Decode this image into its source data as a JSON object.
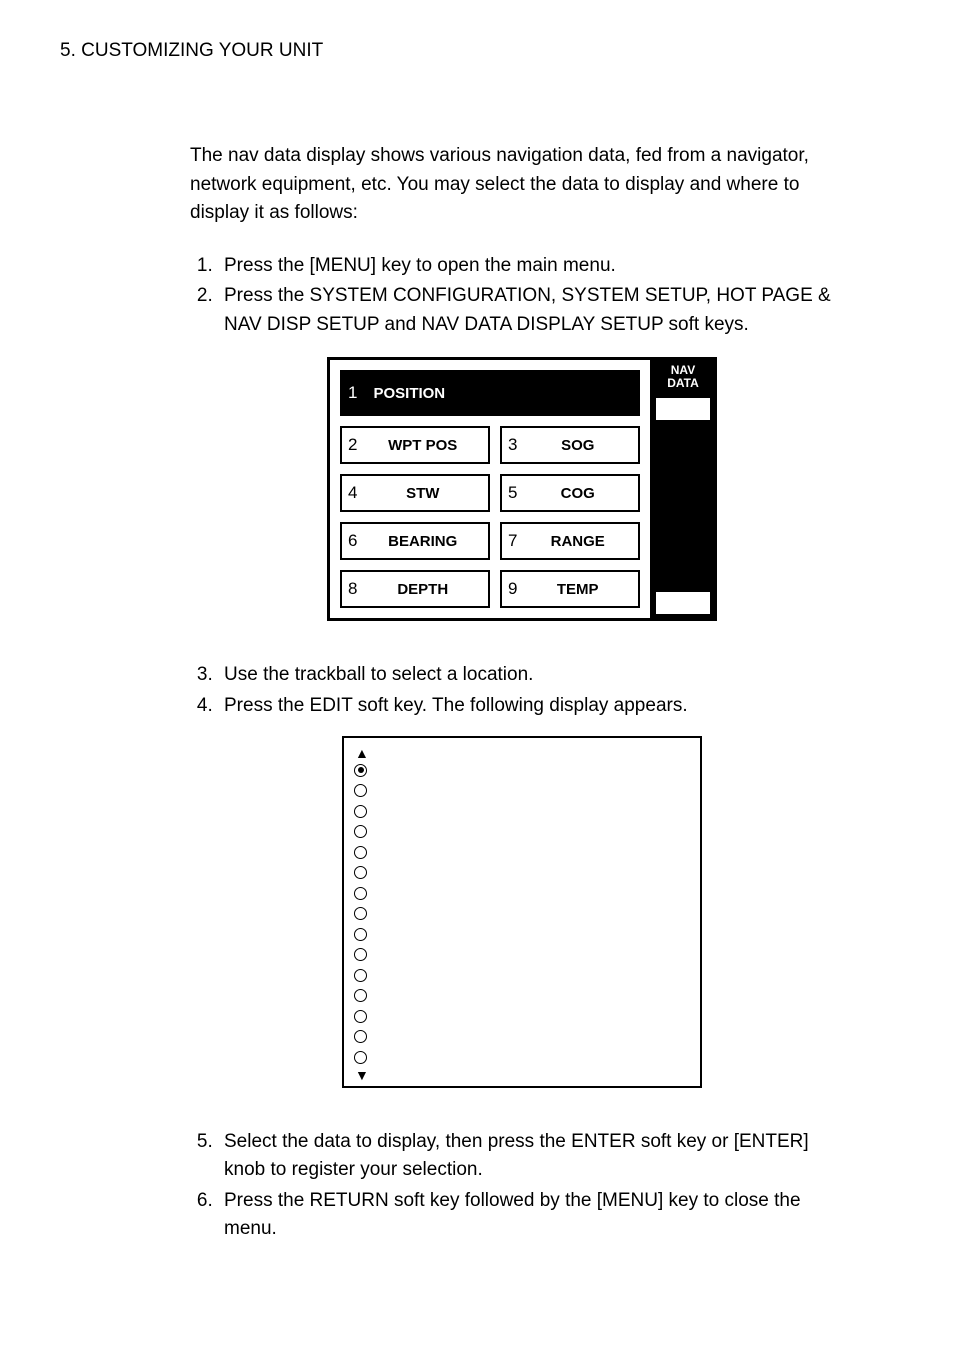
{
  "header": "5. CUSTOMIZING YOUR UNIT",
  "intro": "The nav data display shows various navigation data, fed from a navigator, network equipment, etc. You may select the data to display and where to display it as follows:",
  "steps_a": [
    "Press the [MENU] key to open the main menu.",
    "Press the SYSTEM CONFIGURATION, SYSTEM SETUP, HOT PAGE & NAV DISP SETUP and NAV DATA DISPLAY SETUP soft keys."
  ],
  "panel": {
    "side_label_line1": "NAV",
    "side_label_line2": "DATA",
    "cells": [
      {
        "num": "1",
        "label": "POSITION"
      },
      {
        "num": "2",
        "label": "WPT POS"
      },
      {
        "num": "3",
        "label": "SOG"
      },
      {
        "num": "4",
        "label": "STW"
      },
      {
        "num": "5",
        "label": "COG"
      },
      {
        "num": "6",
        "label": "BEARING"
      },
      {
        "num": "7",
        "label": "RANGE"
      },
      {
        "num": "8",
        "label": "DEPTH"
      },
      {
        "num": "9",
        "label": "TEMP"
      }
    ]
  },
  "steps_b": [
    "Use the trackball to select a location.",
    "Press the EDIT soft key. The following display appears."
  ],
  "options_count": 15,
  "steps_c": [
    "Select the data to display, then press the ENTER soft key or [ENTER] knob to register your selection.",
    "Press the RETURN soft key followed by the [MENU] key to close the menu."
  ]
}
